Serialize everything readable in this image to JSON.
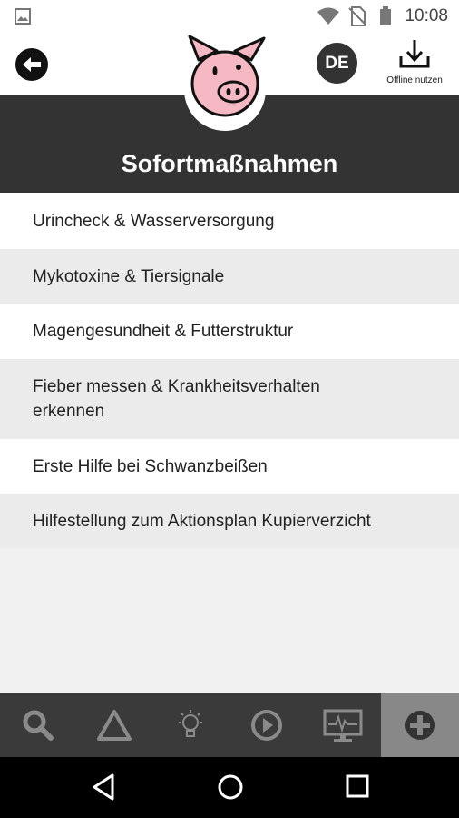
{
  "status_bar": {
    "time": "10:08"
  },
  "app_bar": {
    "language": "DE",
    "offline_label": "Offline nutzen"
  },
  "header": {
    "title": "Sofortmaßnahmen"
  },
  "list": [
    {
      "label": "Urincheck & Wasserversorgung"
    },
    {
      "label": "Mykotoxine & Tiersignale"
    },
    {
      "label": "Magengesundheit & Futterstruktur"
    },
    {
      "label": "Fieber messen & Krankheitsverhalten erkennen"
    },
    {
      "label": "Erste Hilfe bei Schwanzbeißen"
    },
    {
      "label": "Hilfestellung zum Aktionsplan Kupierverzicht"
    }
  ],
  "colors": {
    "header_bg": "#333333",
    "pig_pink": "#f6b8c2",
    "nav_bg": "#3a3a3a",
    "nav_active": "#888888"
  },
  "bottom_nav": [
    {
      "icon": "search-icon"
    },
    {
      "icon": "warning-triangle-icon"
    },
    {
      "icon": "lightbulb-icon"
    },
    {
      "icon": "play-icon"
    },
    {
      "icon": "monitor-icon"
    },
    {
      "icon": "plus-circle-icon",
      "active": true
    }
  ]
}
